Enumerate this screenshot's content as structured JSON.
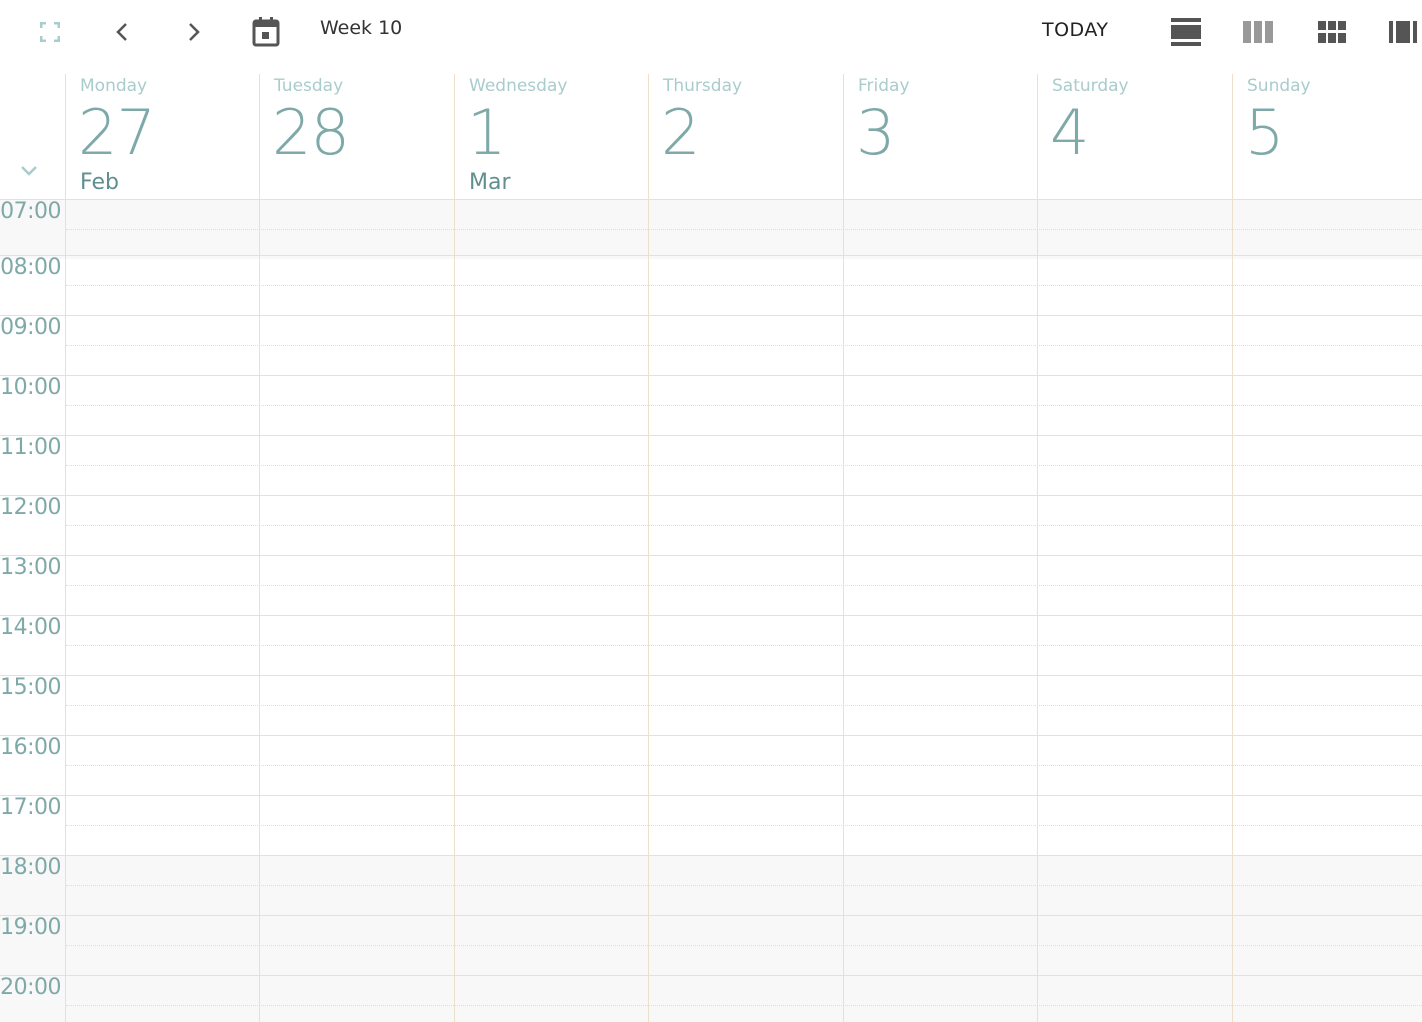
{
  "toolbar": {
    "week_label": "Week 10",
    "today_label": "TODAY",
    "icons": [
      "fullscreen-icon",
      "chevron-left-icon",
      "chevron-right-icon",
      "calendar-icon",
      "day-view-icon",
      "week-view-icon",
      "month-view-icon",
      "agenda-view-icon"
    ]
  },
  "days": [
    {
      "name": "Monday",
      "num": "27",
      "month": "Feb"
    },
    {
      "name": "Tuesday",
      "num": "28",
      "month": ""
    },
    {
      "name": "Wednesday",
      "num": "1",
      "month": "Mar"
    },
    {
      "name": "Thursday",
      "num": "2",
      "month": ""
    },
    {
      "name": "Friday",
      "num": "3",
      "month": ""
    },
    {
      "name": "Saturday",
      "num": "4",
      "month": ""
    },
    {
      "name": "Sunday",
      "num": "5",
      "month": ""
    }
  ],
  "hours": [
    "07:00",
    "08:00",
    "09:00",
    "10:00",
    "11:00",
    "12:00",
    "13:00",
    "14:00",
    "15:00",
    "16:00",
    "17:00",
    "18:00",
    "19:00",
    "20:00"
  ],
  "colors": {
    "grid_line": "#eedfcd",
    "accent": "#7fa9a9",
    "off_hours_bg": "#f8f8f8"
  }
}
